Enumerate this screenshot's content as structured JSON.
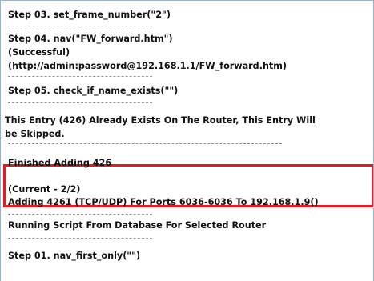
{
  "log": {
    "step03": "Step 03. set_frame_number(\"2\")",
    "step04": "Step 04. nav(\"FW_forward.htm\")",
    "step04_status": "(Successful)",
    "step04_url": "(http://admin:password@192.168.1.1/FW_forward.htm)",
    "step05": "Step 05. check_if_name_exists(\"\")",
    "entry_line1": "This Entry (426) Already Exists On The Router, This Entry Will",
    "entry_line2": "be Skipped.",
    "finished": "Finished Adding 426",
    "current": "(Current -  2/2)",
    "adding": "Adding 4261 (TCP/UDP) For Ports 6036-6036 To 192.168.1.9()",
    "running": "Running Script From Database For Selected Router",
    "step01_partial": "Step 01. nav_first_only(\"\")"
  },
  "colors": {
    "highlight_border": "#e01b24",
    "frame_border": "#9ab0cf",
    "text": "#111111"
  }
}
